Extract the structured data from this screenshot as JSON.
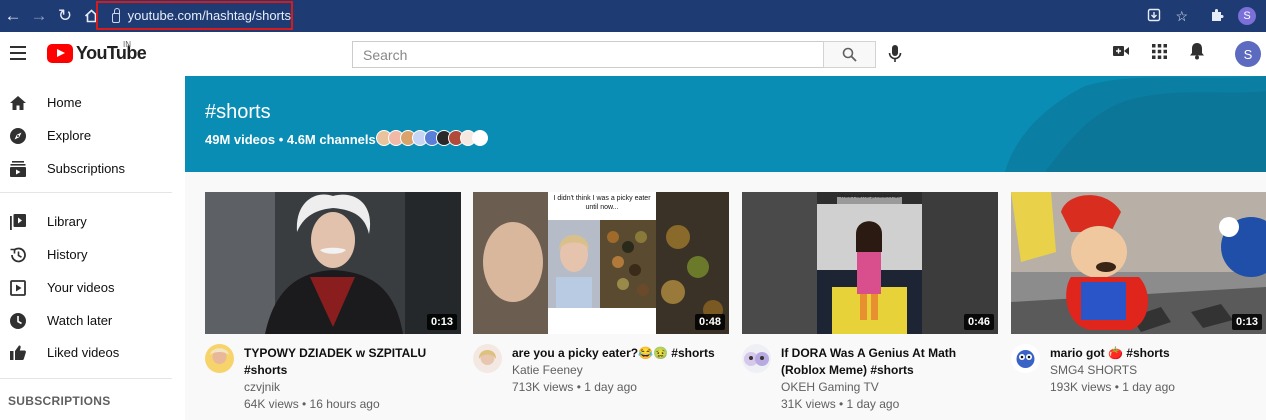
{
  "browser": {
    "url": "youtube.com/hashtag/shorts",
    "profile_initial": "S"
  },
  "header": {
    "logo_text": "YouTube",
    "region": "IN",
    "search_placeholder": "Search",
    "avatar_initial": "S"
  },
  "sidebar": {
    "items": [
      {
        "label": "Home",
        "icon": "home-icon"
      },
      {
        "label": "Explore",
        "icon": "compass-icon"
      },
      {
        "label": "Subscriptions",
        "icon": "subscriptions-icon"
      },
      {
        "label": "Library",
        "icon": "library-icon"
      },
      {
        "label": "History",
        "icon": "history-icon"
      },
      {
        "label": "Your videos",
        "icon": "your-videos-icon"
      },
      {
        "label": "Watch later",
        "icon": "clock-icon"
      },
      {
        "label": "Liked videos",
        "icon": "thumbs-up-icon"
      }
    ],
    "section_title": "SUBSCRIPTIONS"
  },
  "banner": {
    "title": "#shorts",
    "subtitle": "49M videos • 4.6M channels",
    "color": "#0a8db4"
  },
  "videos": [
    {
      "title": "TYPOWY DZIADEK w SZPITALU #shorts",
      "channel": "czvjnik",
      "stats": "64K views • 16 hours ago",
      "duration": "0:13"
    },
    {
      "title": "are you a picky eater?😂🤢 #shorts",
      "channel": "Katie Feeney",
      "stats": "713K views • 1 day ago",
      "duration": "0:48",
      "overlay": "I didn't think I was a picky eater until now..."
    },
    {
      "title": "If DORA Was A Genius At Math (Roblox Meme) #shorts",
      "channel": "OKEH Gaming TV",
      "stats": "31K views • 1 day ago",
      "duration": "0:46",
      "overlay": "Then I ran for president lucas"
    },
    {
      "title": "mario got 🍅 #shorts",
      "channel": "SMG4 SHORTS",
      "stats": "193K views • 1 day ago",
      "duration": "0:13"
    }
  ]
}
